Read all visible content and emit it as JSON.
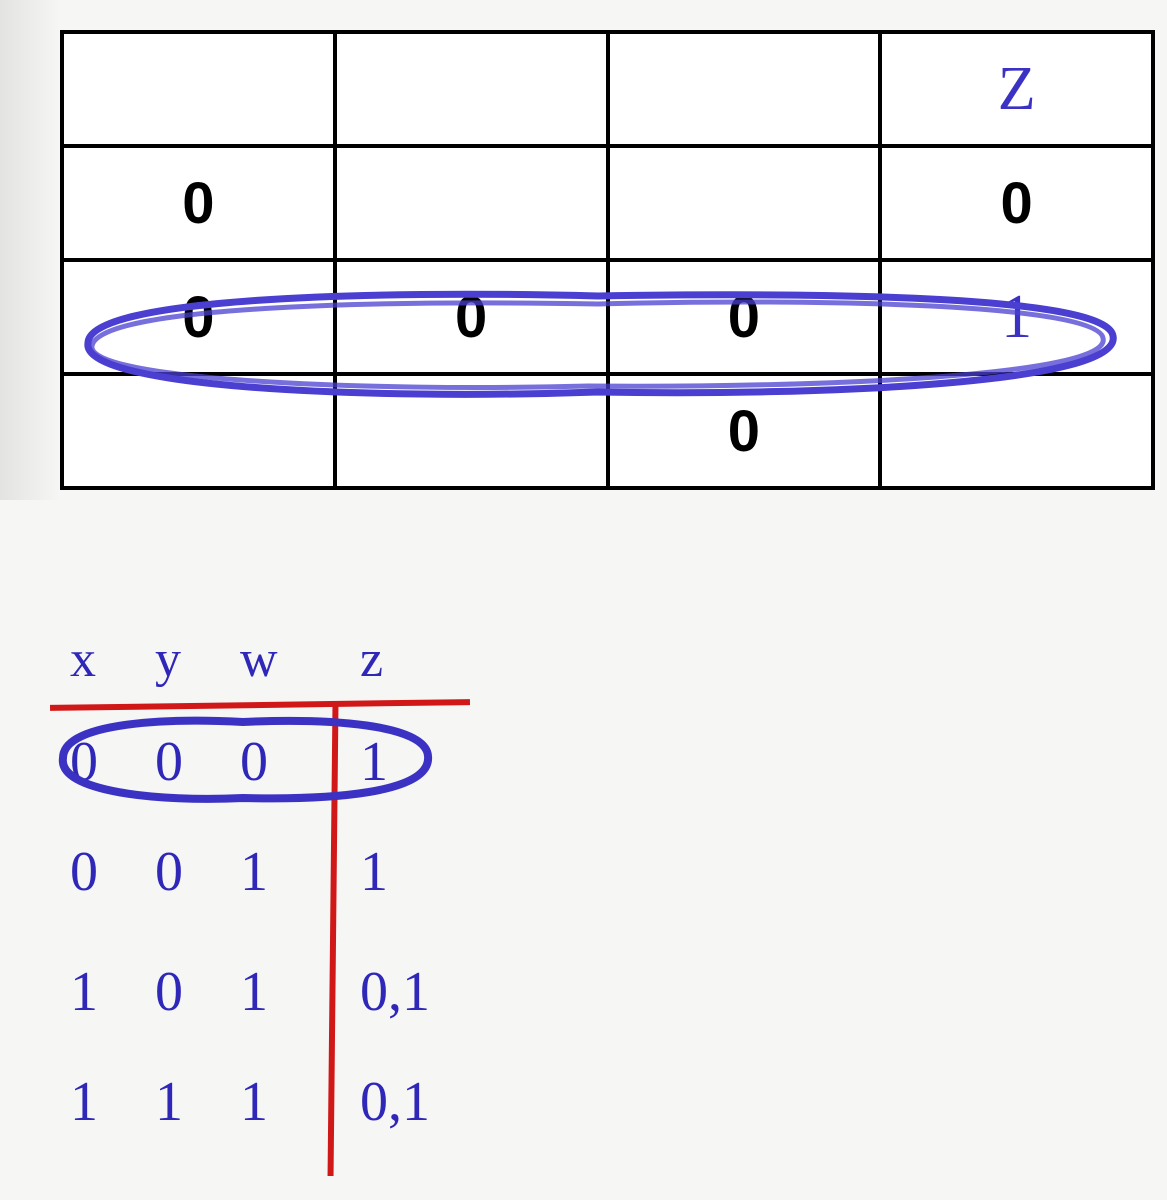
{
  "printed_table": {
    "header": {
      "c0": "",
      "c1": "",
      "c2": "",
      "c3": "Z"
    },
    "rows": [
      {
        "c0": "0",
        "c1": "",
        "c2": "",
        "c3": "0"
      },
      {
        "c0": "0",
        "c1": "0",
        "c2": "0",
        "c3": "1"
      },
      {
        "c0": "",
        "c1": "",
        "c2": "0",
        "c3": ""
      }
    ],
    "circled_row_index": 1
  },
  "hand_table": {
    "headers": [
      "x",
      "y",
      "w",
      "z"
    ],
    "rows": [
      {
        "x": "0",
        "y": "0",
        "w": "0",
        "z": "1"
      },
      {
        "x": "0",
        "y": "0",
        "w": "1",
        "z": "1"
      },
      {
        "x": "1",
        "y": "0",
        "w": "1",
        "z": "0,1"
      },
      {
        "x": "1",
        "y": "1",
        "w": "1",
        "z": "0,1"
      }
    ],
    "circled_row_index": 0
  },
  "colors": {
    "pen_blue": "#3b32c4",
    "pen_red": "#d11818",
    "print_black": "#000000"
  }
}
